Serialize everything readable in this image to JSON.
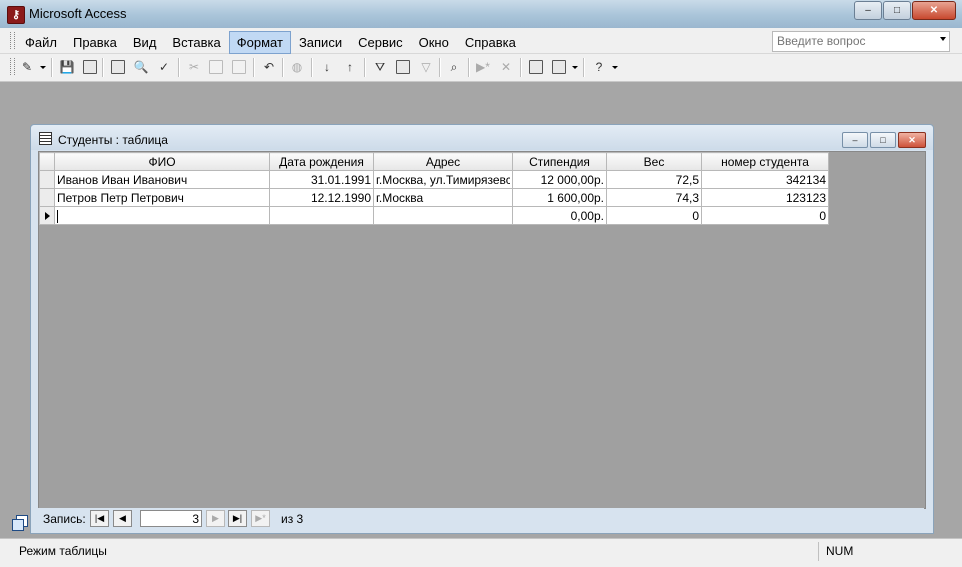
{
  "app": {
    "title": "Microsoft Access",
    "icon": "access-key-icon"
  },
  "window_buttons": {
    "minimize": "–",
    "maximize": "□",
    "close": "✕"
  },
  "menu": {
    "items": [
      "Файл",
      "Правка",
      "Вид",
      "Вставка",
      "Формат",
      "Записи",
      "Сервис",
      "Окно",
      "Справка"
    ],
    "active_index": 4,
    "ask_placeholder": "Введите вопрос"
  },
  "toolbar": {
    "icons": [
      "design-view-icon",
      "save-icon",
      "search-file-icon",
      "print-icon",
      "print-preview-icon",
      "spelling-icon",
      "cut-icon",
      "copy-icon",
      "paste-icon",
      "undo-icon",
      "hyperlink-icon",
      "sort-ascending-icon",
      "sort-descending-icon",
      "filter-by-selection-icon",
      "filter-by-form-icon",
      "apply-filter-icon",
      "find-icon",
      "new-record-icon",
      "delete-record-icon",
      "database-window-icon",
      "new-object-icon",
      "help-icon"
    ]
  },
  "child_window": {
    "title": "Студенты : таблица",
    "buttons": {
      "minimize": "–",
      "maximize": "□",
      "close": "✕"
    }
  },
  "table": {
    "columns": [
      "ФИО",
      "Дата рождения",
      "Адрес",
      "Стипендия",
      "Вес",
      "номер студента"
    ],
    "rows": [
      [
        "Иванов Иван Иванович",
        "31.01.1991",
        "г.Москва, ул.Тимирязевская",
        "12 000,00р.",
        "72,5",
        "342134"
      ],
      [
        "Петров Петр Петрович",
        "12.12.1990",
        "г.Москва",
        "1 600,00р.",
        "74,3",
        "123123"
      ]
    ],
    "new_row": [
      "",
      "",
      "",
      "0,00р.",
      "0",
      "0"
    ]
  },
  "navigation": {
    "label": "Запись:",
    "current": "3",
    "of_text": "из  3",
    "buttons": {
      "first": "|◀",
      "prev": "◀",
      "next": "▶",
      "last": "▶|",
      "new": "▶*"
    }
  },
  "status": {
    "mode": "Режим таблицы",
    "num": "NUM"
  },
  "colors": {
    "accent": "#c1d9f4",
    "background": "#a6a6a6",
    "close_button": "#cd523a"
  }
}
